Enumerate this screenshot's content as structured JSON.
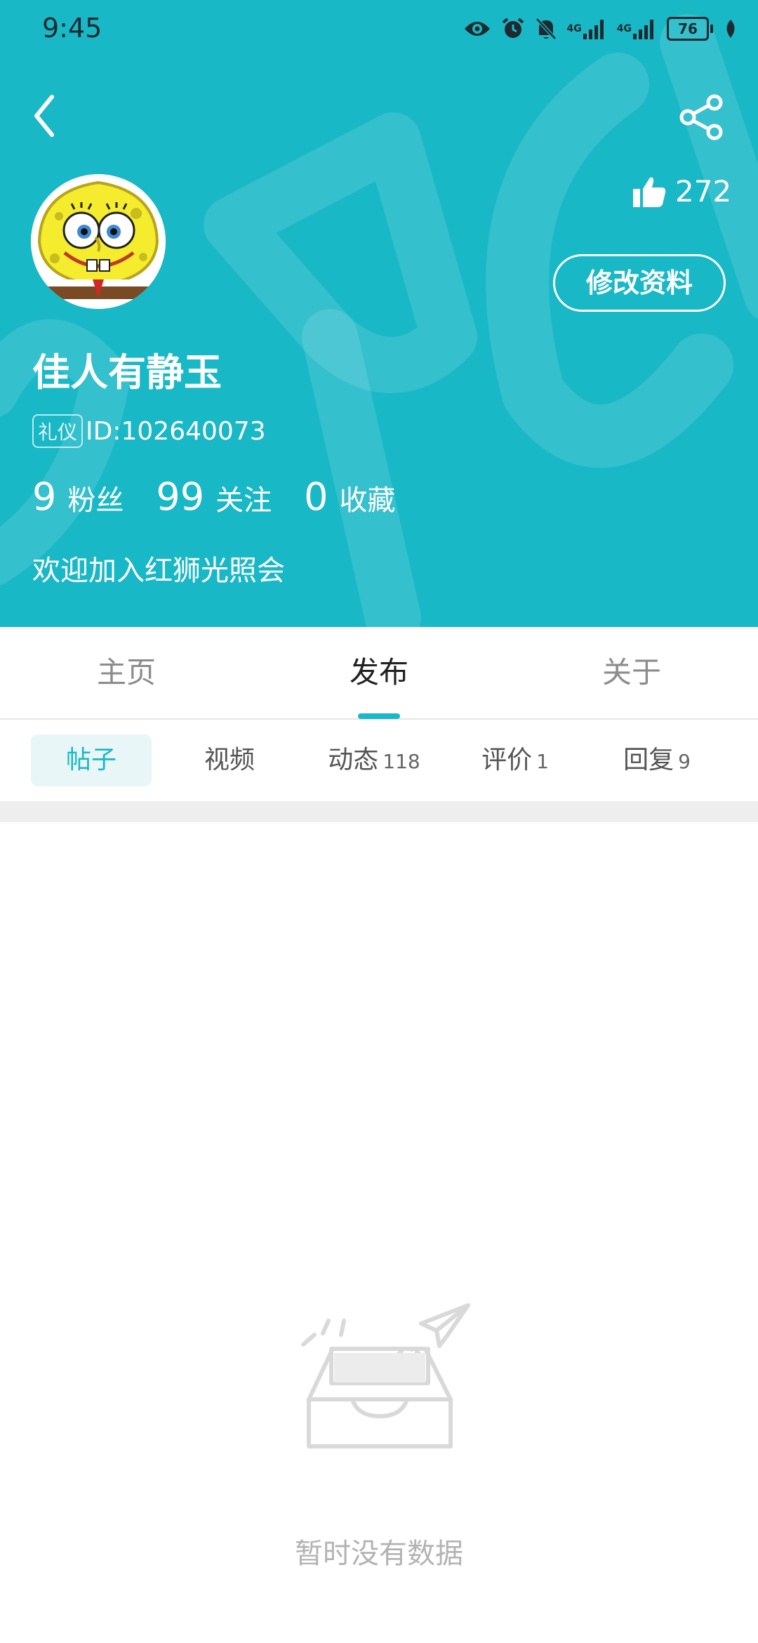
{
  "status_bar": {
    "time": "9:45",
    "battery": "76",
    "network": [
      "4G",
      "4G"
    ]
  },
  "profile": {
    "username": "佳人有静玉",
    "badge": "礼仪",
    "id": "ID:102640073",
    "likes": "272",
    "edit_button": "修改资料",
    "bio": "欢迎加入红狮光照会",
    "stats": [
      {
        "value": "9",
        "label": "粉丝"
      },
      {
        "value": "99",
        "label": "关注"
      },
      {
        "value": "0",
        "label": "收藏"
      }
    ]
  },
  "main_tabs": [
    {
      "label": "主页"
    },
    {
      "label": "发布",
      "active": true
    },
    {
      "label": "关于"
    }
  ],
  "sub_tabs": [
    {
      "label": "帖子",
      "count": "",
      "active": true
    },
    {
      "label": "视频",
      "count": ""
    },
    {
      "label": "动态",
      "count": "118"
    },
    {
      "label": "评价",
      "count": "1"
    },
    {
      "label": "回复",
      "count": "9"
    }
  ],
  "empty_state": {
    "text": "暂时没有数据"
  },
  "colors": {
    "accent": "#19b8c6",
    "header_bg": "#19b8c6"
  },
  "icons": [
    "back-arrow-icon",
    "share-icon",
    "thumbs-up-icon",
    "eye-icon",
    "alarm-icon",
    "mute-bell-icon",
    "signal-icon",
    "battery-icon",
    "leaf-icon",
    "empty-inbox-icon"
  ]
}
